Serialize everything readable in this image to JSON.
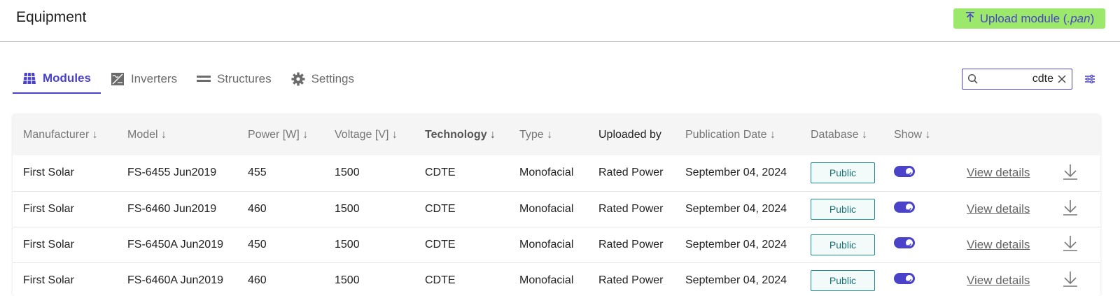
{
  "header": {
    "title": "Equipment",
    "upload_label": "Upload module (",
    "upload_ext": ".pan",
    "upload_close": ")"
  },
  "tabs": [
    {
      "label": "Modules",
      "icon": "grid-icon",
      "active": true
    },
    {
      "label": "Inverters",
      "icon": "inverter-icon",
      "active": false
    },
    {
      "label": "Structures",
      "icon": "structures-icon",
      "active": false
    },
    {
      "label": "Settings",
      "icon": "gear-icon",
      "active": false
    }
  ],
  "search": {
    "value": "cdte",
    "placeholder": ""
  },
  "table": {
    "columns": [
      "Manufacturer ↓",
      "Model ↓",
      "Power [W] ↓",
      "Voltage [V] ↓",
      "Technology ↓",
      "Type ↓",
      "Uploaded by",
      "Publication Date ↓",
      "Database ↓",
      "Show ↓",
      "",
      ""
    ],
    "rows": [
      {
        "manufacturer": "First Solar",
        "model": "FS-6455 Jun2019",
        "power": "455",
        "voltage": "1500",
        "technology": "CDTE",
        "type": "Monofacial",
        "uploaded_by": "Rated Power",
        "date": "September 04, 2024",
        "database": "Public",
        "show": true,
        "link": "View details"
      },
      {
        "manufacturer": "First Solar",
        "model": "FS-6460 Jun2019",
        "power": "460",
        "voltage": "1500",
        "technology": "CDTE",
        "type": "Monofacial",
        "uploaded_by": "Rated Power",
        "date": "September 04, 2024",
        "database": "Public",
        "show": true,
        "link": "View details"
      },
      {
        "manufacturer": "First Solar",
        "model": "FS-6450A Jun2019",
        "power": "450",
        "voltage": "1500",
        "technology": "CDTE",
        "type": "Monofacial",
        "uploaded_by": "Rated Power",
        "date": "September 04, 2024",
        "database": "Public",
        "show": true,
        "link": "View details"
      },
      {
        "manufacturer": "First Solar",
        "model": "FS-6460A Jun2019",
        "power": "460",
        "voltage": "1500",
        "technology": "CDTE",
        "type": "Monofacial",
        "uploaded_by": "Rated Power",
        "date": "September 04, 2024",
        "database": "Public",
        "show": true,
        "link": "View details"
      }
    ]
  },
  "colors": {
    "accent": "#4a42c9",
    "upload_bg": "#9be86a",
    "badge_border": "#1a8a8a"
  }
}
